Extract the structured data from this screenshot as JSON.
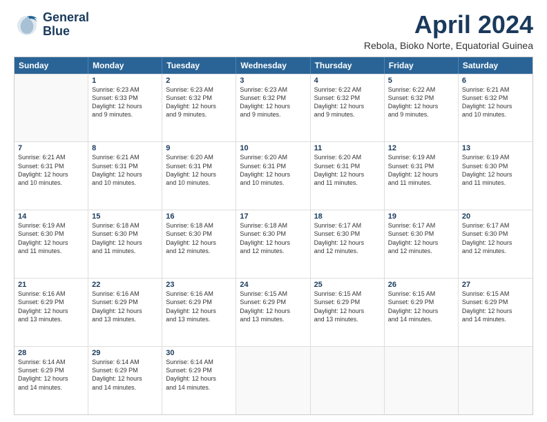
{
  "header": {
    "logo_line1": "General",
    "logo_line2": "Blue",
    "main_title": "April 2024",
    "subtitle": "Rebola, Bioko Norte, Equatorial Guinea"
  },
  "days_of_week": [
    "Sunday",
    "Monday",
    "Tuesday",
    "Wednesday",
    "Thursday",
    "Friday",
    "Saturday"
  ],
  "weeks": [
    [
      {
        "day": "",
        "lines": []
      },
      {
        "day": "1",
        "lines": [
          "Sunrise: 6:23 AM",
          "Sunset: 6:33 PM",
          "Daylight: 12 hours",
          "and 9 minutes."
        ]
      },
      {
        "day": "2",
        "lines": [
          "Sunrise: 6:23 AM",
          "Sunset: 6:32 PM",
          "Daylight: 12 hours",
          "and 9 minutes."
        ]
      },
      {
        "day": "3",
        "lines": [
          "Sunrise: 6:23 AM",
          "Sunset: 6:32 PM",
          "Daylight: 12 hours",
          "and 9 minutes."
        ]
      },
      {
        "day": "4",
        "lines": [
          "Sunrise: 6:22 AM",
          "Sunset: 6:32 PM",
          "Daylight: 12 hours",
          "and 9 minutes."
        ]
      },
      {
        "day": "5",
        "lines": [
          "Sunrise: 6:22 AM",
          "Sunset: 6:32 PM",
          "Daylight: 12 hours",
          "and 9 minutes."
        ]
      },
      {
        "day": "6",
        "lines": [
          "Sunrise: 6:21 AM",
          "Sunset: 6:32 PM",
          "Daylight: 12 hours",
          "and 10 minutes."
        ]
      }
    ],
    [
      {
        "day": "7",
        "lines": [
          "Sunrise: 6:21 AM",
          "Sunset: 6:31 PM",
          "Daylight: 12 hours",
          "and 10 minutes."
        ]
      },
      {
        "day": "8",
        "lines": [
          "Sunrise: 6:21 AM",
          "Sunset: 6:31 PM",
          "Daylight: 12 hours",
          "and 10 minutes."
        ]
      },
      {
        "day": "9",
        "lines": [
          "Sunrise: 6:20 AM",
          "Sunset: 6:31 PM",
          "Daylight: 12 hours",
          "and 10 minutes."
        ]
      },
      {
        "day": "10",
        "lines": [
          "Sunrise: 6:20 AM",
          "Sunset: 6:31 PM",
          "Daylight: 12 hours",
          "and 10 minutes."
        ]
      },
      {
        "day": "11",
        "lines": [
          "Sunrise: 6:20 AM",
          "Sunset: 6:31 PM",
          "Daylight: 12 hours",
          "and 11 minutes."
        ]
      },
      {
        "day": "12",
        "lines": [
          "Sunrise: 6:19 AM",
          "Sunset: 6:31 PM",
          "Daylight: 12 hours",
          "and 11 minutes."
        ]
      },
      {
        "day": "13",
        "lines": [
          "Sunrise: 6:19 AM",
          "Sunset: 6:30 PM",
          "Daylight: 12 hours",
          "and 11 minutes."
        ]
      }
    ],
    [
      {
        "day": "14",
        "lines": [
          "Sunrise: 6:19 AM",
          "Sunset: 6:30 PM",
          "Daylight: 12 hours",
          "and 11 minutes."
        ]
      },
      {
        "day": "15",
        "lines": [
          "Sunrise: 6:18 AM",
          "Sunset: 6:30 PM",
          "Daylight: 12 hours",
          "and 11 minutes."
        ]
      },
      {
        "day": "16",
        "lines": [
          "Sunrise: 6:18 AM",
          "Sunset: 6:30 PM",
          "Daylight: 12 hours",
          "and 12 minutes."
        ]
      },
      {
        "day": "17",
        "lines": [
          "Sunrise: 6:18 AM",
          "Sunset: 6:30 PM",
          "Daylight: 12 hours",
          "and 12 minutes."
        ]
      },
      {
        "day": "18",
        "lines": [
          "Sunrise: 6:17 AM",
          "Sunset: 6:30 PM",
          "Daylight: 12 hours",
          "and 12 minutes."
        ]
      },
      {
        "day": "19",
        "lines": [
          "Sunrise: 6:17 AM",
          "Sunset: 6:30 PM",
          "Daylight: 12 hours",
          "and 12 minutes."
        ]
      },
      {
        "day": "20",
        "lines": [
          "Sunrise: 6:17 AM",
          "Sunset: 6:30 PM",
          "Daylight: 12 hours",
          "and 12 minutes."
        ]
      }
    ],
    [
      {
        "day": "21",
        "lines": [
          "Sunrise: 6:16 AM",
          "Sunset: 6:29 PM",
          "Daylight: 12 hours",
          "and 13 minutes."
        ]
      },
      {
        "day": "22",
        "lines": [
          "Sunrise: 6:16 AM",
          "Sunset: 6:29 PM",
          "Daylight: 12 hours",
          "and 13 minutes."
        ]
      },
      {
        "day": "23",
        "lines": [
          "Sunrise: 6:16 AM",
          "Sunset: 6:29 PM",
          "Daylight: 12 hours",
          "and 13 minutes."
        ]
      },
      {
        "day": "24",
        "lines": [
          "Sunrise: 6:15 AM",
          "Sunset: 6:29 PM",
          "Daylight: 12 hours",
          "and 13 minutes."
        ]
      },
      {
        "day": "25",
        "lines": [
          "Sunrise: 6:15 AM",
          "Sunset: 6:29 PM",
          "Daylight: 12 hours",
          "and 13 minutes."
        ]
      },
      {
        "day": "26",
        "lines": [
          "Sunrise: 6:15 AM",
          "Sunset: 6:29 PM",
          "Daylight: 12 hours",
          "and 14 minutes."
        ]
      },
      {
        "day": "27",
        "lines": [
          "Sunrise: 6:15 AM",
          "Sunset: 6:29 PM",
          "Daylight: 12 hours",
          "and 14 minutes."
        ]
      }
    ],
    [
      {
        "day": "28",
        "lines": [
          "Sunrise: 6:14 AM",
          "Sunset: 6:29 PM",
          "Daylight: 12 hours",
          "and 14 minutes."
        ]
      },
      {
        "day": "29",
        "lines": [
          "Sunrise: 6:14 AM",
          "Sunset: 6:29 PM",
          "Daylight: 12 hours",
          "and 14 minutes."
        ]
      },
      {
        "day": "30",
        "lines": [
          "Sunrise: 6:14 AM",
          "Sunset: 6:29 PM",
          "Daylight: 12 hours",
          "and 14 minutes."
        ]
      },
      {
        "day": "",
        "lines": []
      },
      {
        "day": "",
        "lines": []
      },
      {
        "day": "",
        "lines": []
      },
      {
        "day": "",
        "lines": []
      }
    ]
  ]
}
